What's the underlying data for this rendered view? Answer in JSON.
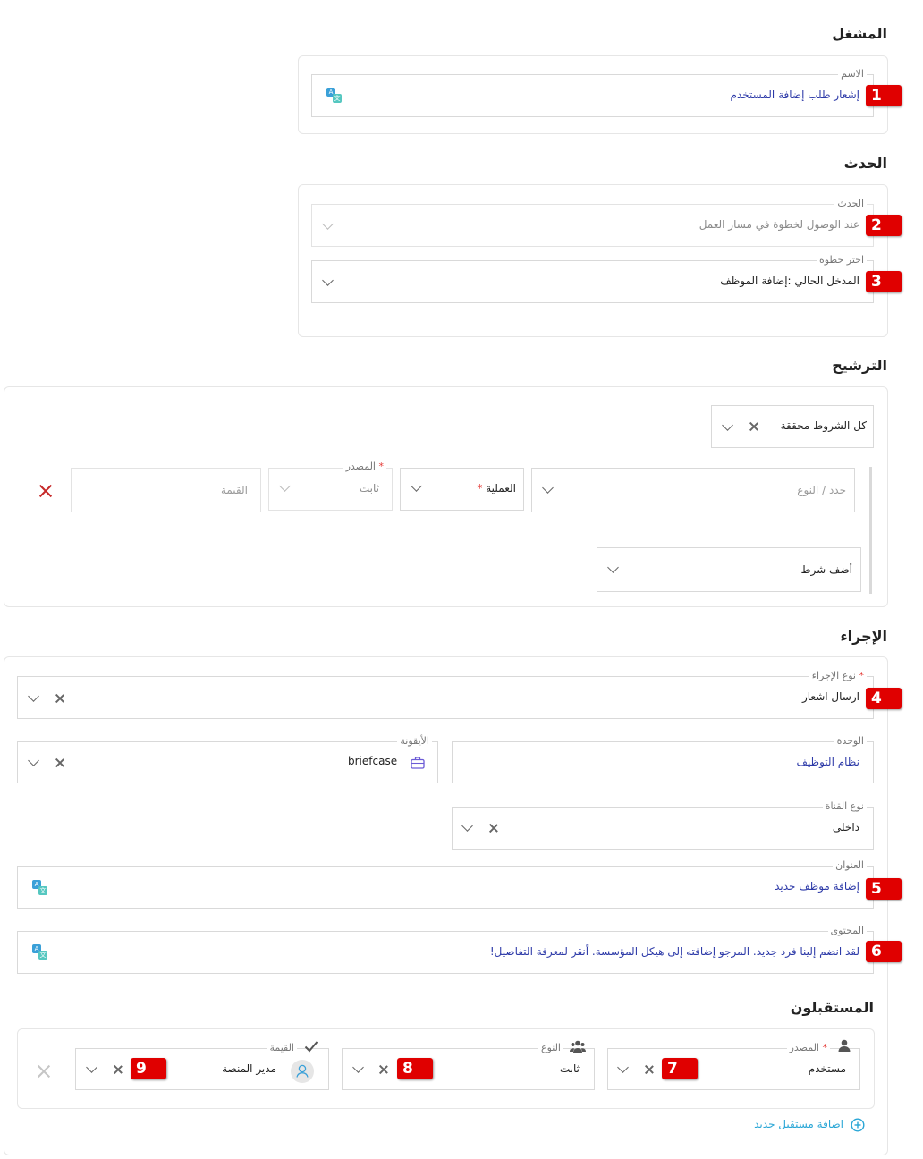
{
  "operator": {
    "title": "المشغل",
    "name_label": "الاسم",
    "name_value": "إشعار طلب إضافة المستخدم"
  },
  "event": {
    "title": "الحدث",
    "event_label": "الحدث",
    "event_value": "عند الوصول لخطوة في مسار العمل",
    "step_label": "اختر خطوة",
    "step_value": "المدخل الحالي :إضافة الموظف"
  },
  "filter": {
    "title": "الترشيح",
    "conditions_value": "كل الشروط محققة",
    "type_placeholder": "حدد / النوع",
    "operation_label": "العملية",
    "source_label": "المصدر",
    "source_value": "ثابت",
    "value_placeholder": "القيمة",
    "add_condition": "أضف شرط"
  },
  "action": {
    "title": "الإجراء",
    "action_type_label": "نوع الإجراء",
    "action_type_value": "ارسال اشعار",
    "unit_label": "الوحدة",
    "unit_value": "نظام التوظيف",
    "icon_label": "الأيقونة",
    "icon_value": "briefcase",
    "channel_label": "نوع القناة",
    "channel_value": "داخلي",
    "subject_label": "العنوان",
    "subject_value": "إضافة موظف جديد",
    "content_label": "المحتوى",
    "content_value": "لقد انضم إلينا فرد جديد. المرجو إضافته إلى هيكل المؤسسة. أنقر لمعرفة التفاصيل!"
  },
  "recipients": {
    "title": "المستقبلون",
    "source_label": "المصدر",
    "source_value": "مستخدم",
    "type_label": "النوع",
    "type_value": "ثابت",
    "value_label": "القيمة",
    "value_value": "مدير المنصة",
    "add_recipient": "اضافة مستقبل جديد"
  },
  "badges": [
    "1",
    "2",
    "3",
    "4",
    "5",
    "6",
    "7",
    "8",
    "9"
  ],
  "icons": {
    "translate": "translate-icon",
    "briefcase": "briefcase-icon",
    "user": "user-icon",
    "group": "group-icon",
    "check": "check-icon",
    "plus": "plus-circle-icon"
  },
  "colors": {
    "badge": "#e00000",
    "value_blue": "#2d3aa8",
    "accent_teal": "#29a6d6",
    "required": "#e53935",
    "remove_red": "#c62828"
  }
}
